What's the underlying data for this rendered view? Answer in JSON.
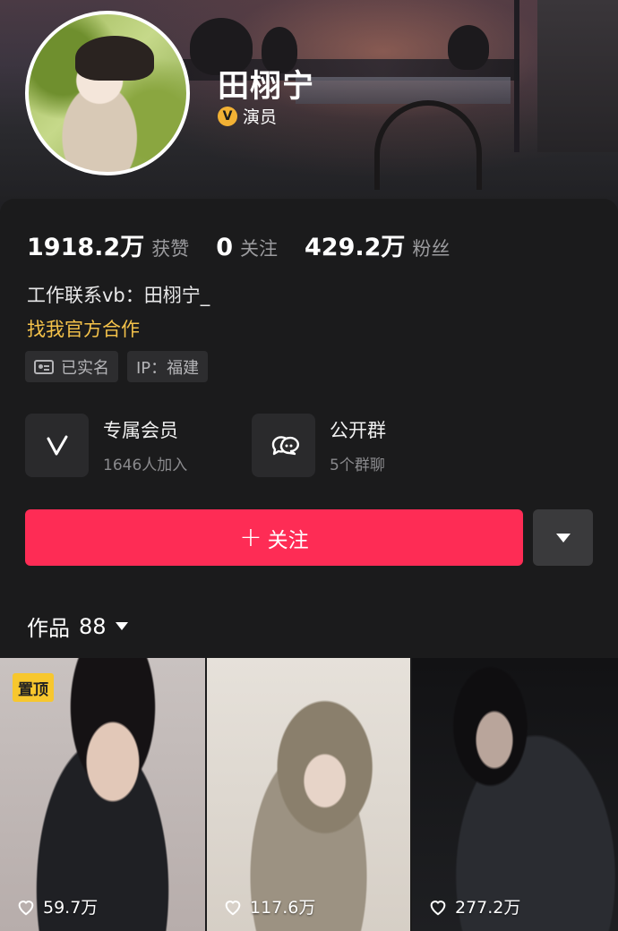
{
  "profile": {
    "name": "田栩宁",
    "verify_badge": "V",
    "verify_label": "演员"
  },
  "stats": [
    {
      "value": "1918.2万",
      "label": "获赞"
    },
    {
      "value": "0",
      "label": "关注"
    },
    {
      "value": "429.2万",
      "label": "粉丝"
    }
  ],
  "bio": {
    "line": "工作联系vb：田栩宁_",
    "business_link": "找我官方合作"
  },
  "tags": [
    {
      "label": "已实名",
      "icon": "id-card-icon"
    },
    {
      "label": "IP：福建"
    }
  ],
  "features": [
    {
      "title": "专属会员",
      "subtitle": "1646人加入",
      "icon": "vip-v-icon"
    },
    {
      "title": "公开群",
      "subtitle": "5个群聊",
      "icon": "chat-group-icon"
    }
  ],
  "actions": {
    "follow_label": "关注",
    "follow_plus": "+",
    "more_icon": "caret-down-icon"
  },
  "works": {
    "label": "作品",
    "count": "88"
  },
  "videos": [
    {
      "pin": "置顶",
      "likes": "59.7万"
    },
    {
      "likes": "117.6万"
    },
    {
      "likes": "277.2万"
    }
  ],
  "colors": {
    "follow_button": "#fe2c55",
    "business_link": "#f4c24a",
    "pin_badge": "#f7c72e",
    "verify_badge": "#f2b134"
  }
}
